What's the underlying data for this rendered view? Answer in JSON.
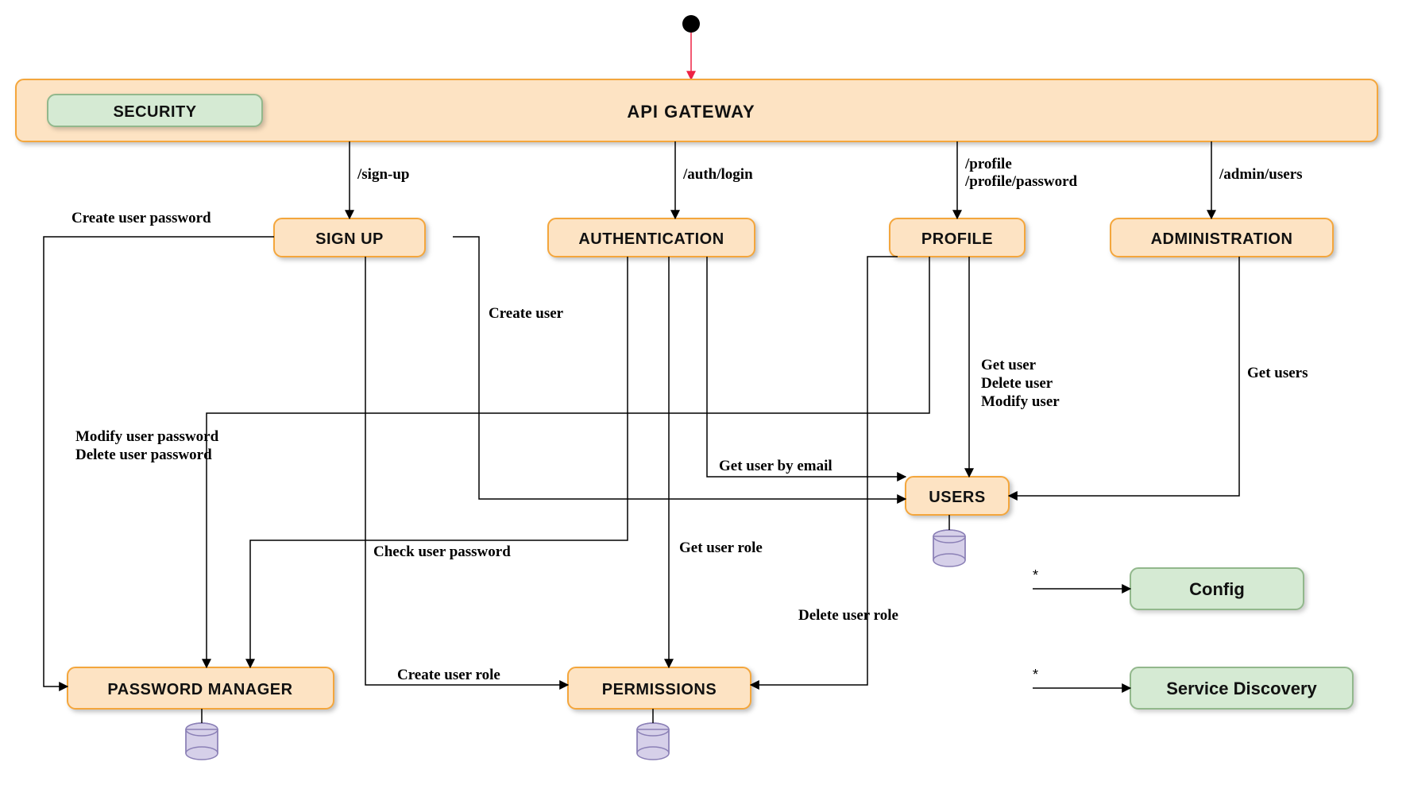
{
  "nodes": {
    "security": {
      "label": "SECURITY"
    },
    "gateway": {
      "label": "API GATEWAY"
    },
    "signup": {
      "label": "SIGN UP"
    },
    "authentication": {
      "label": "AUTHENTICATION"
    },
    "profile": {
      "label": "PROFILE"
    },
    "administration": {
      "label": "ADMINISTRATION"
    },
    "password_manager": {
      "label": "PASSWORD MANAGER"
    },
    "permissions": {
      "label": "PERMISSIONS"
    },
    "users": {
      "label": "USERS"
    },
    "config": {
      "label": "Config"
    },
    "service_discovery": {
      "label": "Service Discovery"
    }
  },
  "edges": {
    "gateway_signup": "/sign-up",
    "gateway_auth": "/auth/login",
    "gateway_profile1": "/profile",
    "gateway_profile2": "/profile/password",
    "gateway_admin": "/admin/users",
    "create_user_password": "Create user password",
    "create_user": "Create user",
    "modify_user_password": "Modify user password",
    "delete_user_password": "Delete user password",
    "check_user_password": "Check user password",
    "create_user_role": "Create user role",
    "get_user_by_email": "Get user by email",
    "get_user_role": "Get user role",
    "delete_user_role": "Delete user role",
    "get_user": "Get user",
    "delete_user": "Delete user",
    "modify_user": "Modify user",
    "get_users": "Get users",
    "star1": "*",
    "star2": "*"
  }
}
